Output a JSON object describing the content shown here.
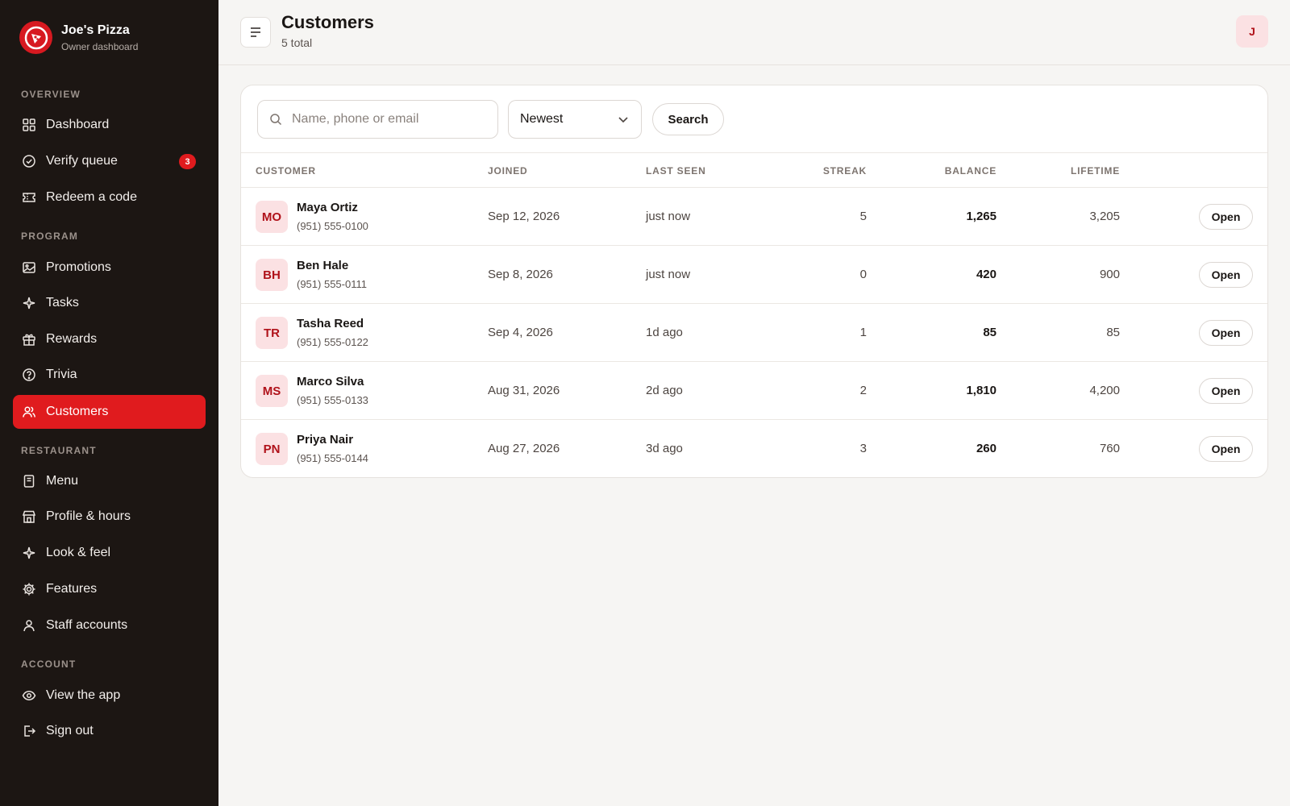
{
  "brand": {
    "name": "Joe's Pizza",
    "subtitle": "Owner dashboard"
  },
  "sidebar": {
    "sections": [
      {
        "label": "OVERVIEW",
        "items": [
          {
            "label": "Dashboard",
            "icon": "grid-icon"
          },
          {
            "label": "Verify queue",
            "icon": "check-circle-icon",
            "badge": "3"
          },
          {
            "label": "Redeem a code",
            "icon": "ticket-icon"
          }
        ]
      },
      {
        "label": "PROGRAM",
        "items": [
          {
            "label": "Promotions",
            "icon": "image-icon"
          },
          {
            "label": "Tasks",
            "icon": "sparkle-icon"
          },
          {
            "label": "Rewards",
            "icon": "gift-icon"
          },
          {
            "label": "Trivia",
            "icon": "help-circle-icon"
          },
          {
            "label": "Customers",
            "icon": "users-icon",
            "active": true
          }
        ]
      },
      {
        "label": "RESTAURANT",
        "items": [
          {
            "label": "Menu",
            "icon": "menu-doc-icon"
          },
          {
            "label": "Profile & hours",
            "icon": "store-icon"
          },
          {
            "label": "Look & feel",
            "icon": "sparkle-icon"
          },
          {
            "label": "Features",
            "icon": "gear-icon"
          },
          {
            "label": "Staff accounts",
            "icon": "user-icon"
          }
        ]
      },
      {
        "label": "ACCOUNT",
        "items": [
          {
            "label": "View the app",
            "icon": "eye-icon"
          },
          {
            "label": "Sign out",
            "icon": "logout-icon"
          }
        ]
      }
    ]
  },
  "header": {
    "title": "Customers",
    "subtitle": "5 total",
    "avatar_initial": "J"
  },
  "filters": {
    "search_placeholder": "Name, phone or email",
    "search_value": "",
    "sort_selected": "Newest",
    "search_button": "Search"
  },
  "table": {
    "columns": [
      "CUSTOMER",
      "JOINED",
      "LAST SEEN",
      "STREAK",
      "BALANCE",
      "LIFETIME"
    ],
    "open_label": "Open",
    "rows": [
      {
        "initials": "MO",
        "name": "Maya Ortiz",
        "phone": "(951) 555-0100",
        "joined": "Sep 12, 2026",
        "last_seen": "just now",
        "streak": "5",
        "balance": "1,265",
        "lifetime": "3,205"
      },
      {
        "initials": "BH",
        "name": "Ben Hale",
        "phone": "(951) 555-0111",
        "joined": "Sep 8, 2026",
        "last_seen": "just now",
        "streak": "0",
        "balance": "420",
        "lifetime": "900"
      },
      {
        "initials": "TR",
        "name": "Tasha Reed",
        "phone": "(951) 555-0122",
        "joined": "Sep 4, 2026",
        "last_seen": "1d ago",
        "streak": "1",
        "balance": "85",
        "lifetime": "85"
      },
      {
        "initials": "MS",
        "name": "Marco Silva",
        "phone": "(951) 555-0133",
        "joined": "Aug 31, 2026",
        "last_seen": "2d ago",
        "streak": "2",
        "balance": "1,810",
        "lifetime": "4,200"
      },
      {
        "initials": "PN",
        "name": "Priya Nair",
        "phone": "(951) 555-0144",
        "joined": "Aug 27, 2026",
        "last_seen": "3d ago",
        "streak": "3",
        "balance": "260",
        "lifetime": "760"
      }
    ]
  },
  "colors": {
    "accent": "#e01b1e",
    "sidebar_bg": "#1c1613",
    "avatar_bg": "#fbe1e3"
  }
}
